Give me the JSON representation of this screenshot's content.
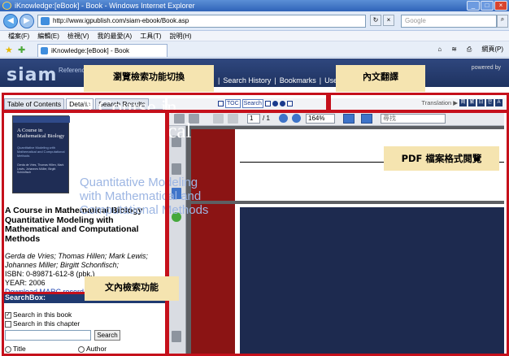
{
  "window": {
    "title": "iKnowledge:[eBook] - Book - Windows Internet Explorer",
    "min": "_",
    "max": "□",
    "close": "×"
  },
  "address": {
    "url": "http://www.igpublish.com/siam-ebook/Book.asp",
    "search_placeholder": "Google"
  },
  "menu": [
    "檔案(F)",
    "編輯(E)",
    "檢視(V)",
    "我的最愛(A)",
    "工具(T)",
    "說明(H)"
  ],
  "tab": {
    "label": "iKnowledge:[eBook] - Book"
  },
  "toolbar_right": {
    "page_label": "網頁(P)"
  },
  "banner": {
    "logo": "siam",
    "logo_sub": "Reference",
    "powered_by": "powered by",
    "nav": [
      "Search History",
      "Bookmarks",
      "User G"
    ]
  },
  "annotations": {
    "browse": "瀏覽檢索功能切換",
    "translate": "內文翻譯",
    "pdf": "PDF 檔案格式閱覽",
    "search": "文內檢索功能"
  },
  "left_panel": {
    "tabs": [
      "Table of Contents",
      "Details",
      "Search Results"
    ],
    "cover": {
      "title": "A Course in Mathematical Biology",
      "subtitle": "Quantitative Modeling with Mathematical and Computational Methods",
      "authors": "Gerda de Vries, Thomas Hillen, Mark Lewis, Johannes Müller, Birgitt Schönfisch"
    },
    "book_title": "A Course in Mathematical Biology Quantitative Modeling with Mathematical and Computational Methods",
    "authors": "Gerda de Vries; Thomas Hillen; Mark Lewis; Johannes Miller; Birgitt Schonfisch;",
    "isbn": "ISBN: 0-89871-612-8 (pbk.)",
    "year": "YEAR: 2006",
    "marc": "Download MARC record",
    "searchbox": {
      "header": "SearchBox:",
      "in_book": "Search in this book",
      "in_chapter": "Search in this chapter",
      "button": "Search",
      "opt_title": "Title",
      "opt_author": "Author"
    }
  },
  "nav_controls": {
    "toc": "TOC",
    "search": "Search"
  },
  "translation": {
    "label": "Translation",
    "buttons": [
      "简",
      "繁",
      "日",
      "한",
      "A"
    ]
  },
  "pdf_toolbar": {
    "page": "1",
    "total": "/ 1",
    "zoom": "164%",
    "find_placeholder": "尋找"
  },
  "pdf_page": {
    "title_lines": [
      "A Course in",
      "Mathematical",
      "Biology"
    ],
    "sub_lines": [
      "Quantitative Modeling",
      "with Mathematical and",
      "Computational Methods"
    ]
  },
  "colors": {
    "highlight": "#c5101b",
    "annotation_bg": "#f5e4b0",
    "banner": "#1e3260",
    "cover_bg": "#1d2a4f"
  }
}
